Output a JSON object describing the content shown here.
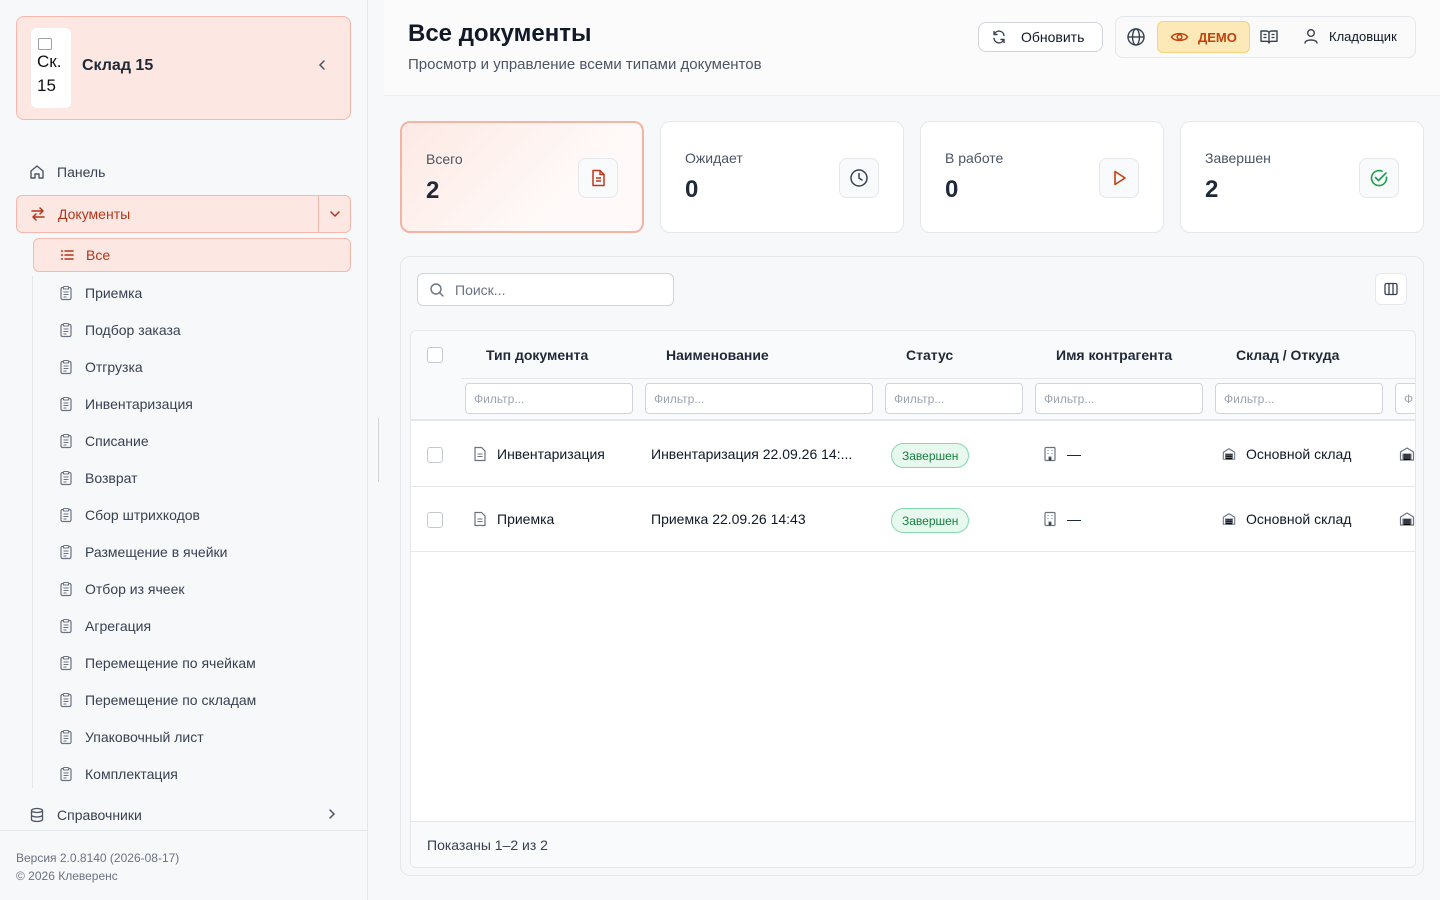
{
  "brand": {
    "logo_alt": "Ск. 15",
    "name": "Склад 15"
  },
  "nav": {
    "panel_label": "Панель",
    "documents_label": "Документы",
    "directories_label": "Справочники",
    "sub_items": [
      {
        "label": "Все",
        "icon": "list-icon",
        "active": true
      },
      {
        "label": "Приемка",
        "icon": "clipboard-icon"
      },
      {
        "label": "Подбор заказа",
        "icon": "clipboard-icon"
      },
      {
        "label": "Отгрузка",
        "icon": "clipboard-icon"
      },
      {
        "label": "Инвентаризация",
        "icon": "clipboard-icon"
      },
      {
        "label": "Списание",
        "icon": "clipboard-icon"
      },
      {
        "label": "Возврат",
        "icon": "clipboard-icon"
      },
      {
        "label": "Сбор штрихкодов",
        "icon": "clipboard-icon"
      },
      {
        "label": "Размещение в ячейки",
        "icon": "clipboard-icon"
      },
      {
        "label": "Отбор из ячеек",
        "icon": "clipboard-icon"
      },
      {
        "label": "Агрегация",
        "icon": "clipboard-icon"
      },
      {
        "label": "Перемещение по ячейкам",
        "icon": "clipboard-icon"
      },
      {
        "label": "Перемещение по складам",
        "icon": "clipboard-icon"
      },
      {
        "label": "Упаковочный лист",
        "icon": "clipboard-icon"
      },
      {
        "label": "Комплектация",
        "icon": "clipboard-icon"
      }
    ]
  },
  "footer": {
    "version": "Версия 2.0.8140 (2026-08-17)",
    "copyright": "© 2026 Клеверенс"
  },
  "header": {
    "title": "Все документы",
    "subtitle": "Просмотр и управление всеми типами документов",
    "refresh_label": "Обновить",
    "demo_label": "ДЕМО",
    "user_label": "Кладовщик"
  },
  "stats": [
    {
      "label": "Всего",
      "value": "2",
      "icon": "document-icon",
      "color": "#c2361b"
    },
    {
      "label": "Ожидает",
      "value": "0",
      "icon": "clock-icon",
      "color": "#374151"
    },
    {
      "label": "В работе",
      "value": "0",
      "icon": "play-icon",
      "color": "#c2410c"
    },
    {
      "label": "Завершен",
      "value": "2",
      "icon": "check-circle-icon",
      "color": "#16a34a"
    }
  ],
  "table": {
    "search_placeholder": "Поиск...",
    "filter_placeholder": "Фильтр...",
    "filter_cut": "Ф",
    "columns": [
      "Тип документа",
      "Наименование",
      "Статус",
      "Имя контрагента",
      "Склад / Откуда"
    ],
    "rows": [
      {
        "type": "Инвентаризация",
        "name": "Инвентаризация 22.09.26 14:...",
        "status": "Завершен",
        "contractor": "—",
        "warehouse": "Основной склад"
      },
      {
        "type": "Приемка",
        "name": "Приемка 22.09.26 14:43",
        "status": "Завершен",
        "contractor": "—",
        "warehouse": "Основной склад"
      }
    ],
    "footer": "Показаны 1–2 из 2"
  }
}
